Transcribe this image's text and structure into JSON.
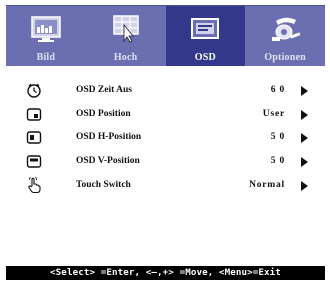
{
  "tabs": [
    {
      "label": "Bild",
      "icon": "monitor-picture-icon",
      "active": false
    },
    {
      "label": "Hoch",
      "icon": "grid-cursor-icon",
      "active": false
    },
    {
      "label": "OSD",
      "icon": "osd-window-icon",
      "active": true
    },
    {
      "label": "Optionen",
      "icon": "options-tools-icon",
      "active": false
    }
  ],
  "menu": {
    "items": [
      {
        "label": "OSD Zeit Aus",
        "value": "6 0",
        "icon": "clock-icon"
      },
      {
        "label": "OSD Position",
        "value": "User",
        "icon": "position-icon"
      },
      {
        "label": "OSD H-Position",
        "value": "5 0",
        "icon": "h-position-icon"
      },
      {
        "label": "OSD V-Position",
        "value": "5 0",
        "icon": "v-position-icon"
      },
      {
        "label": "Touch Switch",
        "value": "Normal",
        "icon": "touch-hand-icon"
      }
    ]
  },
  "status": {
    "text": "<Select> =Enter, <–,+> =Move, <Menu>=Exit"
  },
  "colors": {
    "tab_bar": "#6b6fb1",
    "tab_active": "#34388a",
    "status_bar": "#000000"
  }
}
